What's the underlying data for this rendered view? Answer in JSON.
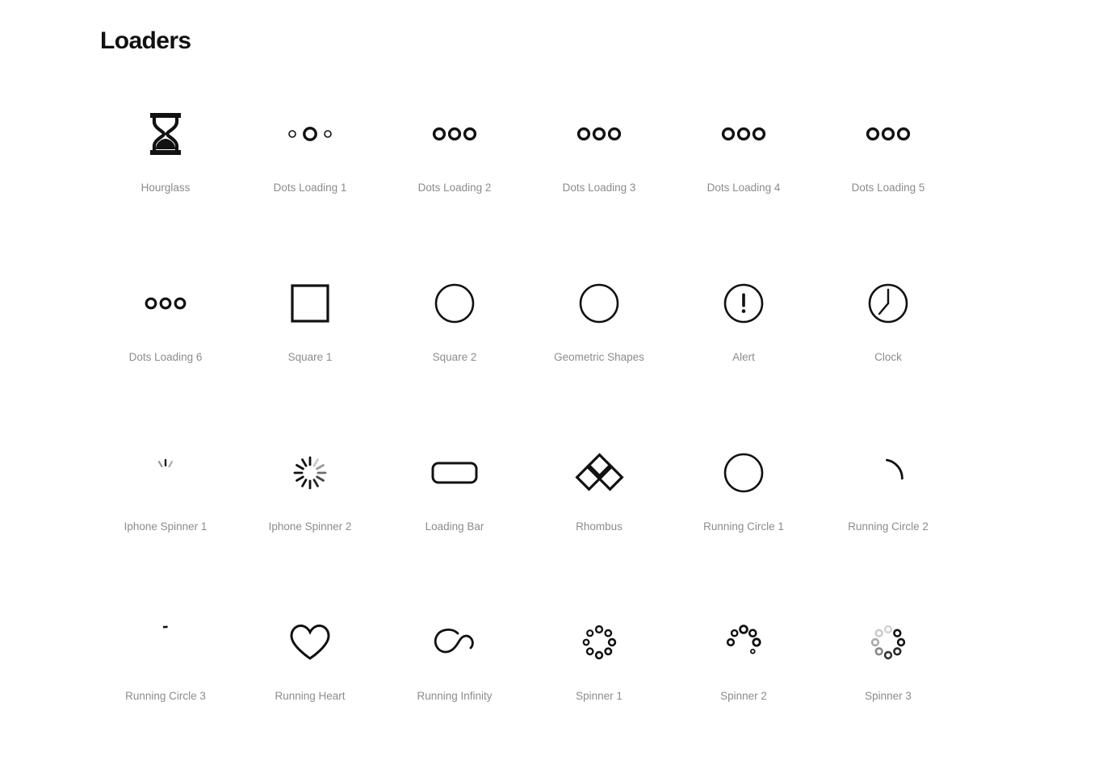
{
  "page": {
    "title": "Loaders",
    "background_color": "#ffffff",
    "icon_color": "#111111",
    "label_color": "#8c8c90"
  },
  "grid": {
    "columns": 6,
    "rows": 4,
    "items": [
      {
        "label": "Hourglass",
        "icon": "hourglass-icon"
      },
      {
        "label": "Dots Loading 1",
        "icon": "dots-loading-1-icon"
      },
      {
        "label": "Dots Loading 2",
        "icon": "dots-loading-2-icon"
      },
      {
        "label": "Dots Loading 3",
        "icon": "dots-loading-3-icon"
      },
      {
        "label": "Dots Loading 4",
        "icon": "dots-loading-4-icon"
      },
      {
        "label": "Dots Loading 5",
        "icon": "dots-loading-5-icon"
      },
      {
        "label": "Dots Loading 6",
        "icon": "dots-loading-6-icon"
      },
      {
        "label": "Square 1",
        "icon": "square-1-icon"
      },
      {
        "label": "Square 2",
        "icon": "square-2-icon"
      },
      {
        "label": "Geometric Shapes",
        "icon": "geometric-shapes-icon"
      },
      {
        "label": "Alert",
        "icon": "alert-icon"
      },
      {
        "label": "Clock",
        "icon": "clock-icon"
      },
      {
        "label": "Iphone Spinner 1",
        "icon": "iphone-spinner-1-icon"
      },
      {
        "label": "Iphone Spinner 2",
        "icon": "iphone-spinner-2-icon"
      },
      {
        "label": "Loading Bar",
        "icon": "loading-bar-icon"
      },
      {
        "label": "Rhombus",
        "icon": "rhombus-icon"
      },
      {
        "label": "Running Circle 1",
        "icon": "running-circle-1-icon"
      },
      {
        "label": "Running Circle 2",
        "icon": "running-circle-2-icon"
      },
      {
        "label": "Running Circle 3",
        "icon": "running-circle-3-icon"
      },
      {
        "label": "Running Heart",
        "icon": "running-heart-icon"
      },
      {
        "label": "Running Infinity",
        "icon": "running-infinity-icon"
      },
      {
        "label": "Spinner 1",
        "icon": "spinner-1-icon"
      },
      {
        "label": "Spinner 2",
        "icon": "spinner-2-icon"
      },
      {
        "label": "Spinner 3",
        "icon": "spinner-3-icon"
      }
    ]
  }
}
